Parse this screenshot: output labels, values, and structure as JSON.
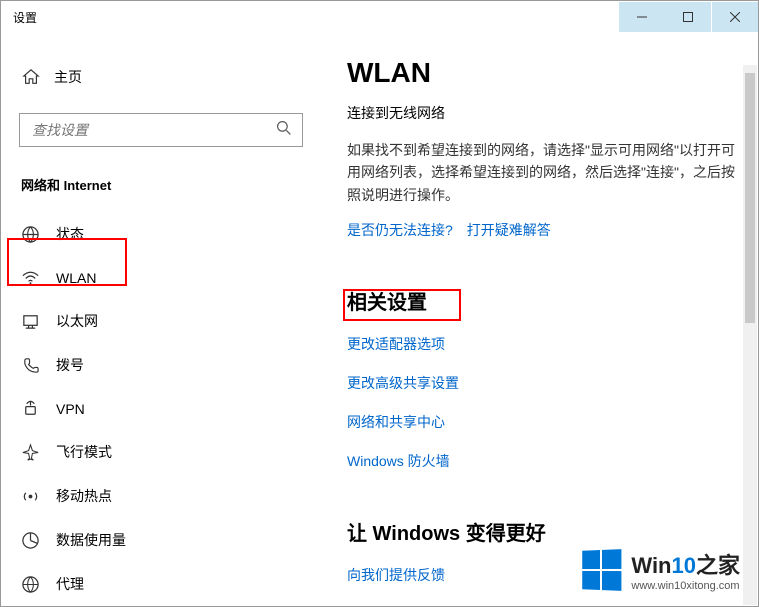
{
  "titlebar": {
    "title": "设置"
  },
  "sidebar": {
    "home": "主页",
    "search_placeholder": "查找设置",
    "category": "网络和 Internet",
    "items": [
      {
        "label": "状态"
      },
      {
        "label": "WLAN"
      },
      {
        "label": "以太网"
      },
      {
        "label": "拨号"
      },
      {
        "label": "VPN"
      },
      {
        "label": "飞行模式"
      },
      {
        "label": "移动热点"
      },
      {
        "label": "数据使用量"
      },
      {
        "label": "代理"
      }
    ]
  },
  "main": {
    "heading": "WLAN",
    "subhead": "连接到无线网络",
    "helptext": "如果找不到希望连接到的网络，请选择\"显示可用网络\"以打开可用网络列表，选择希望连接到的网络，然后选择\"连接\"，之后按照说明进行操作。",
    "help_link1": "是否仍无法连接?",
    "help_link2": "打开疑难解答",
    "related_title": "相关设置",
    "related_links": [
      "更改适配器选项",
      "更改高级共享设置",
      "网络和共享中心",
      "Windows 防火墙"
    ],
    "better_title": "让 Windows 变得更好",
    "feedback_link": "向我们提供反馈"
  },
  "watermark": {
    "brand_pre": "Win",
    "brand_num": "10",
    "brand_post": "之家",
    "url": "www.win10xitong.com"
  }
}
